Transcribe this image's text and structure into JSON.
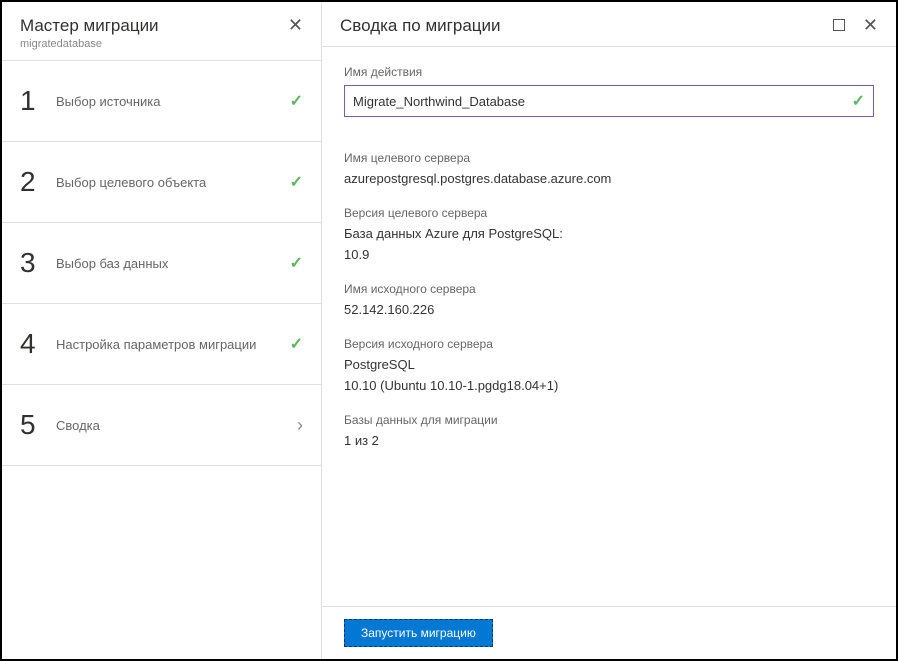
{
  "sidebar": {
    "title": "Мастер миграции",
    "subtitle": "migratedatabase",
    "steps": [
      {
        "num": "1",
        "label": "Выбор источника",
        "done": true
      },
      {
        "num": "2",
        "label": "Выбор целевого объекта",
        "done": true
      },
      {
        "num": "3",
        "label": "Выбор баз данных",
        "done": true
      },
      {
        "num": "4",
        "label": "Настройка параметров миграции",
        "done": true
      },
      {
        "num": "5",
        "label": "Сводка",
        "done": false
      }
    ]
  },
  "main": {
    "title": "Сводка по миграции",
    "action_name_label": "Имя действия",
    "action_name_value": "Migrate_Northwind_Database",
    "target_server_label": "Имя целевого сервера",
    "target_server_value": "azurepostgresql.postgres.database.azure.com",
    "target_version_label": "Версия целевого сервера",
    "target_version_value1": "База данных Azure для PostgreSQL:",
    "target_version_value2": "10.9",
    "source_server_label": "Имя исходного сервера",
    "source_server_value": "52.142.160.226",
    "source_version_label": "Версия исходного сервера",
    "source_version_value1": "PostgreSQL",
    "source_version_value2": "10.10 (Ubuntu 10.10-1.pgdg18.04+1)",
    "databases_label": "Базы данных для миграции",
    "databases_value": "1 из 2",
    "run_button": "Запустить миграцию"
  }
}
